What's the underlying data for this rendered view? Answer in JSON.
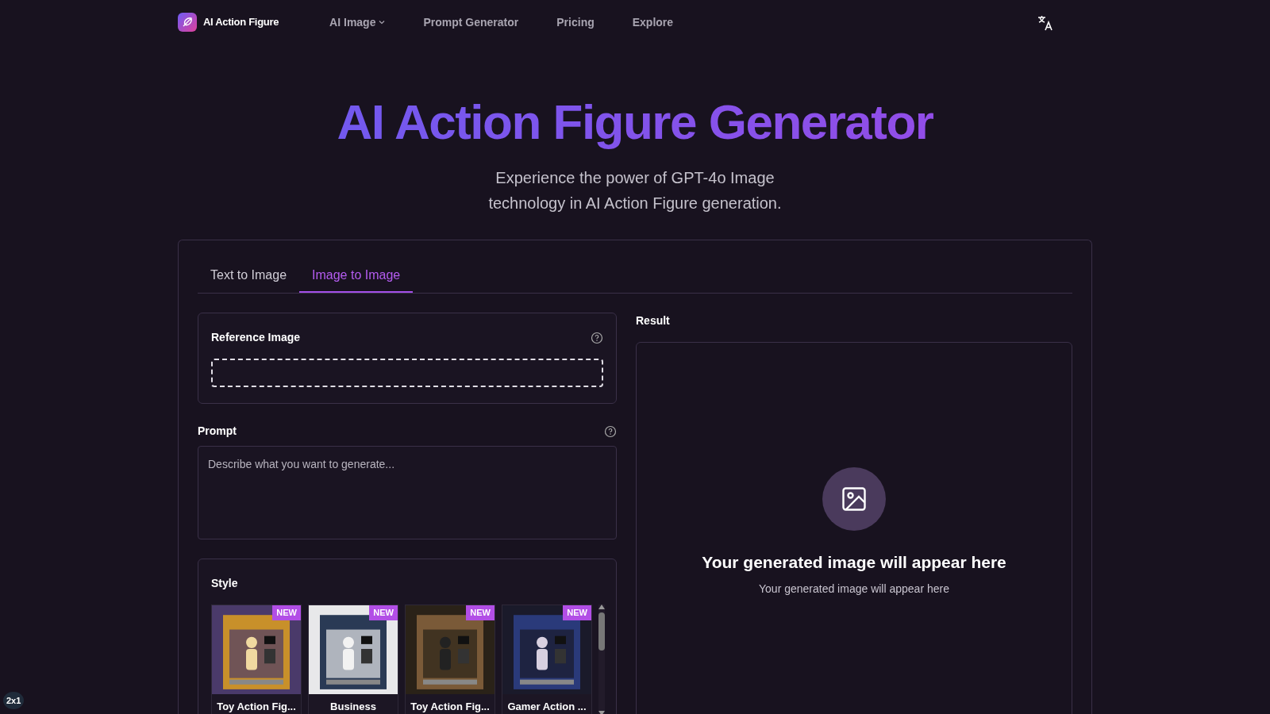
{
  "brand": {
    "name": "AI Action Figure"
  },
  "nav": [
    {
      "label": "AI Image",
      "dropdown": true
    },
    {
      "label": "Prompt Generator",
      "dropdown": false
    },
    {
      "label": "Pricing",
      "dropdown": false
    },
    {
      "label": "Explore",
      "dropdown": false
    }
  ],
  "hero": {
    "title": "AI Action Figure Generator",
    "subtitle_lines": [
      "Experience the power of GPT-4o Image",
      "technology in AI Action Figure generation."
    ]
  },
  "tabs": [
    {
      "label": "Text to Image",
      "selected": false
    },
    {
      "label": "Image to Image",
      "selected": true
    }
  ],
  "reference_image": {
    "label": "Reference Image"
  },
  "prompt": {
    "label": "Prompt",
    "placeholder": "Describe what you want to generate..."
  },
  "style": {
    "label": "Style",
    "items": [
      {
        "name": "Toy Action Fig...",
        "badge": "NEW"
      },
      {
        "name": "Business",
        "badge": "NEW"
      },
      {
        "name": "Toy Action Fig...",
        "badge": "NEW"
      },
      {
        "name": "Gamer Action ...",
        "badge": "NEW"
      }
    ]
  },
  "result": {
    "label": "Result",
    "heading": "Your generated image will appear here",
    "note": "Your generated image will appear here"
  },
  "corner_badge": "2x1"
}
